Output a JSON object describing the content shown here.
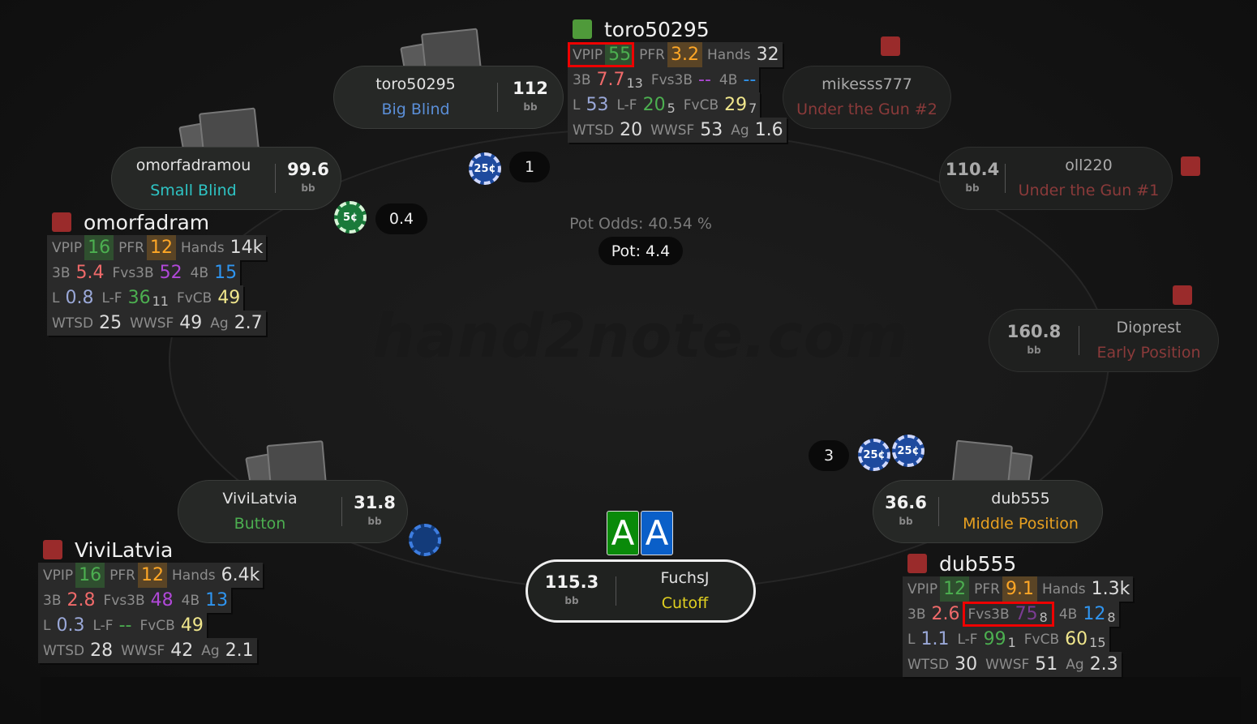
{
  "watermark": "hand2note.com",
  "pot_odds": "Pot Odds: 40.54 %",
  "pot": "Pot: 4.4",
  "hero_cards": [
    "A",
    "A"
  ],
  "hero_card_colors": [
    "#0a8a0a",
    "#0a5fc8"
  ],
  "bets": {
    "sb": "0.4",
    "bb": "1",
    "mp": "3"
  },
  "chips": {
    "sb": "5¢",
    "bb": "25¢",
    "mp1": "25¢",
    "mp2": "25¢"
  },
  "seats": {
    "bb": {
      "name": "toro50295",
      "position": "Big Blind",
      "stack": "112",
      "unit": "bb",
      "pos_color": "#5b8fd8"
    },
    "utg2": {
      "name": "mikesss777",
      "position": "Under the Gun #2",
      "pos_color": "#8a3a3a"
    },
    "sb": {
      "name": "omorfadramou",
      "position": "Small Blind",
      "stack": "99.6",
      "unit": "bb",
      "pos_color": "#2ec4c4"
    },
    "utg1": {
      "name": "oll220",
      "position": "Under the Gun #1",
      "stack": "110.4",
      "unit": "bb",
      "pos_color": "#8a3a3a"
    },
    "ep": {
      "name": "Dioprest",
      "position": "Early Position",
      "stack": "160.8",
      "unit": "bb",
      "pos_color": "#8a3a3a"
    },
    "btn": {
      "name": "ViviLatvia",
      "position": "Button",
      "stack": "31.8",
      "unit": "bb",
      "pos_color": "#4caf50"
    },
    "mp": {
      "name": "dub555",
      "position": "Middle Position",
      "stack": "36.6",
      "unit": "bb",
      "pos_color": "#e8a020"
    },
    "co": {
      "name": "FuchsJ",
      "position": "Cutoff",
      "stack": "115.3",
      "unit": "bb",
      "pos_color": "#e0d020"
    }
  },
  "huds": {
    "bb": {
      "title": "toro50295",
      "vpip": "55",
      "pfr": "3.2",
      "hands": "32",
      "b3": "7.7",
      "b3n": "13",
      "fvs3b": "--",
      "b4": "--",
      "l": "53",
      "lf": "20",
      "lfn": "5",
      "fvcb": "29",
      "fvcbn": "7",
      "wtsd": "20",
      "wwsf": "53",
      "ag": "1.6"
    },
    "sb": {
      "title": "omorfadram",
      "vpip": "16",
      "pfr": "12",
      "hands": "14k",
      "b3": "5.4",
      "fvs3b": "52",
      "b4": "15",
      "l": "0.8",
      "lf": "36",
      "lfn": "11",
      "fvcb": "49",
      "wtsd": "25",
      "wwsf": "49",
      "ag": "2.7"
    },
    "btn": {
      "title": "ViviLatvia",
      "vpip": "16",
      "pfr": "12",
      "hands": "6.4k",
      "b3": "2.8",
      "fvs3b": "48",
      "b4": "13",
      "l": "0.3",
      "lf": "--",
      "fvcb": "49",
      "wtsd": "28",
      "wwsf": "42",
      "ag": "2.1"
    },
    "mp": {
      "title": "dub555",
      "vpip": "12",
      "pfr": "9.1",
      "hands": "1.3k",
      "b3": "2.6",
      "fvs3b": "75",
      "fvs3bn": "8",
      "b4": "12",
      "b4n": "8",
      "l": "1.1",
      "lf": "99",
      "lfn": "1",
      "fvcb": "60",
      "fvcbn": "15",
      "wtsd": "30",
      "wwsf": "51",
      "ag": "2.3"
    }
  },
  "labels": {
    "vpip": "VPIP",
    "pfr": "PFR",
    "hands": "Hands",
    "b3": "3B",
    "fvs3b": "Fvs3B",
    "b4": "4B",
    "l": "L",
    "lf": "L-F",
    "fvcb": "FvCB",
    "wtsd": "WTSD",
    "wwsf": "WWSF",
    "ag": "Ag"
  }
}
